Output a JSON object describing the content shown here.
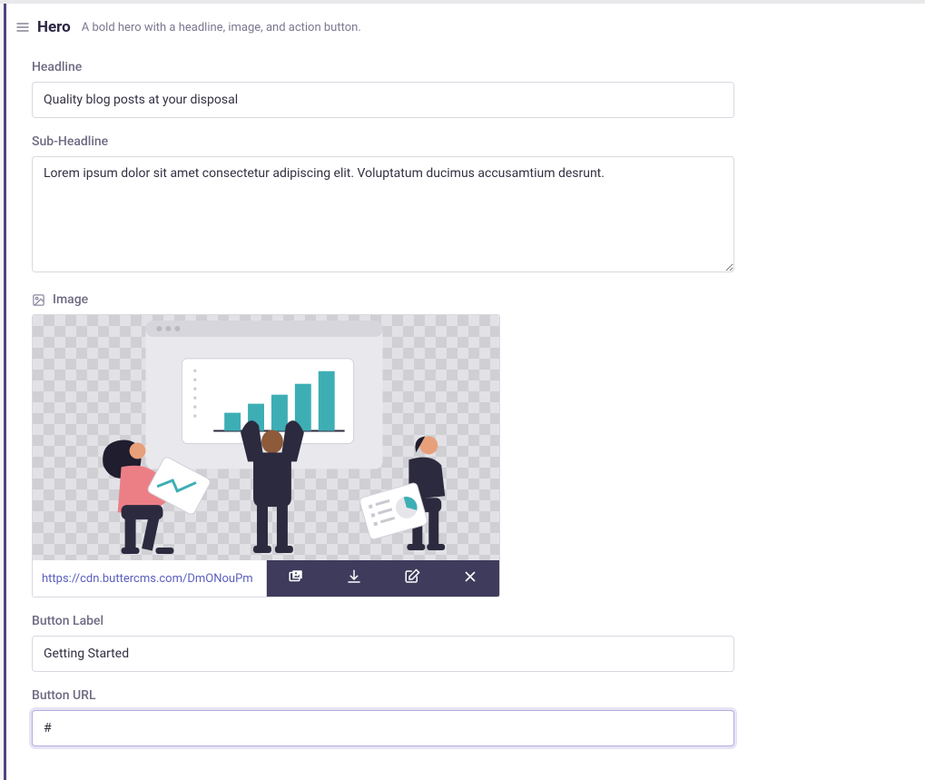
{
  "section": {
    "title": "Hero",
    "description": "A bold hero with a headline, image, and action button."
  },
  "fields": {
    "headline": {
      "label": "Headline",
      "value": "Quality blog posts at your disposal"
    },
    "sub_headline": {
      "label": "Sub-Headline",
      "value": "Lorem ipsum dolor sit amet consectetur adipiscing elit. Voluptatum ducimus accusamtium desrunt."
    },
    "image": {
      "label": "Image",
      "url": "https://cdn.buttercms.com/DmONouPm"
    },
    "button_label": {
      "label": "Button Label",
      "value": "Getting Started"
    },
    "button_url": {
      "label": "Button URL",
      "value": "#"
    }
  }
}
